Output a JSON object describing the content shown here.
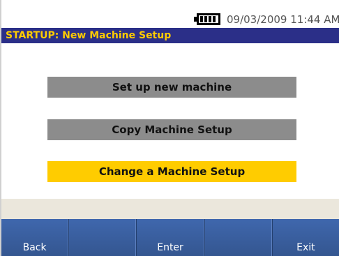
{
  "status_bar": {
    "battery_icon": "battery-full-icon",
    "datetime": "09/03/2009 11:44 AM"
  },
  "title_bar": {
    "title": "STARTUP: New Machine Setup"
  },
  "menu": {
    "items": [
      {
        "label": "Set up new machine",
        "selected": false
      },
      {
        "label": "Copy Machine Setup",
        "selected": false
      },
      {
        "label": "Change a Machine Setup",
        "selected": true
      }
    ]
  },
  "message": {
    "text": ""
  },
  "softkeys": [
    {
      "label": "Back"
    },
    {
      "label": ""
    },
    {
      "label": "Enter"
    },
    {
      "label": ""
    },
    {
      "label": "Exit"
    }
  ],
  "colors": {
    "title_bar_bg": "#2b2f88",
    "title_text": "#ffcc00",
    "menu_item_normal": "#8c8c8c",
    "menu_item_selected": "#ffcc00",
    "softkey_bg": "#3f67ad",
    "message_bar_bg": "#ebe7dc"
  }
}
